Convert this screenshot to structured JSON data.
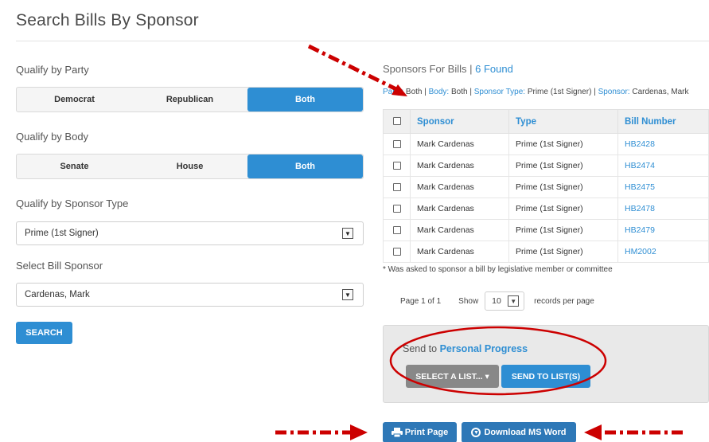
{
  "page": {
    "title": "Search Bills By Sponsor"
  },
  "party": {
    "label": "Qualify by Party",
    "options": [
      "Democrat",
      "Republican",
      "Both"
    ],
    "selected": "Both"
  },
  "body": {
    "label": "Qualify by Body",
    "options": [
      "Senate",
      "House",
      "Both"
    ],
    "selected": "Both"
  },
  "sponsor_type": {
    "label": "Qualify by Sponsor Type",
    "value": "Prime (1st Signer)"
  },
  "sponsor": {
    "label": "Select Bill Sponsor",
    "value": "Cardenas, Mark"
  },
  "search_button": "SEARCH",
  "results": {
    "heading": "Sponsors For Bills",
    "sep": "|",
    "found": "6 Found",
    "filters": {
      "party_key": "Party:",
      "party_val": "Both",
      "body_key": "Body:",
      "body_val": "Both",
      "type_key": "Sponsor Type:",
      "type_val": "Prime (1st Signer)",
      "sponsor_key": "Sponsor:",
      "sponsor_val": "Cardenas, Mark"
    },
    "columns": [
      "Sponsor",
      "Type",
      "Bill Number"
    ],
    "rows": [
      {
        "sponsor": "Mark Cardenas",
        "type": "Prime (1st Signer)",
        "bill": "HB2428"
      },
      {
        "sponsor": "Mark Cardenas",
        "type": "Prime (1st Signer)",
        "bill": "HB2474"
      },
      {
        "sponsor": "Mark Cardenas",
        "type": "Prime (1st Signer)",
        "bill": "HB2475"
      },
      {
        "sponsor": "Mark Cardenas",
        "type": "Prime (1st Signer)",
        "bill": "HB2478"
      },
      {
        "sponsor": "Mark Cardenas",
        "type": "Prime (1st Signer)",
        "bill": "HB2479"
      },
      {
        "sponsor": "Mark Cardenas",
        "type": "Prime (1st Signer)",
        "bill": "HM2002"
      }
    ],
    "note": "* Was asked to sponsor a bill by legislative member or committee"
  },
  "pager": {
    "page_text": "Page 1 of 1",
    "show": "Show",
    "per_page": "10",
    "suffix": "records per page"
  },
  "send": {
    "prefix": "Send to",
    "target": "Personal Progress",
    "select_list": "SELECT A LIST... ▾",
    "send_button": "SEND TO LIST(S)"
  },
  "actions": {
    "print": "Print Page",
    "word": "Download MS Word"
  },
  "colors": {
    "accent": "#2e8ed3",
    "annotation": "#cc0000"
  }
}
